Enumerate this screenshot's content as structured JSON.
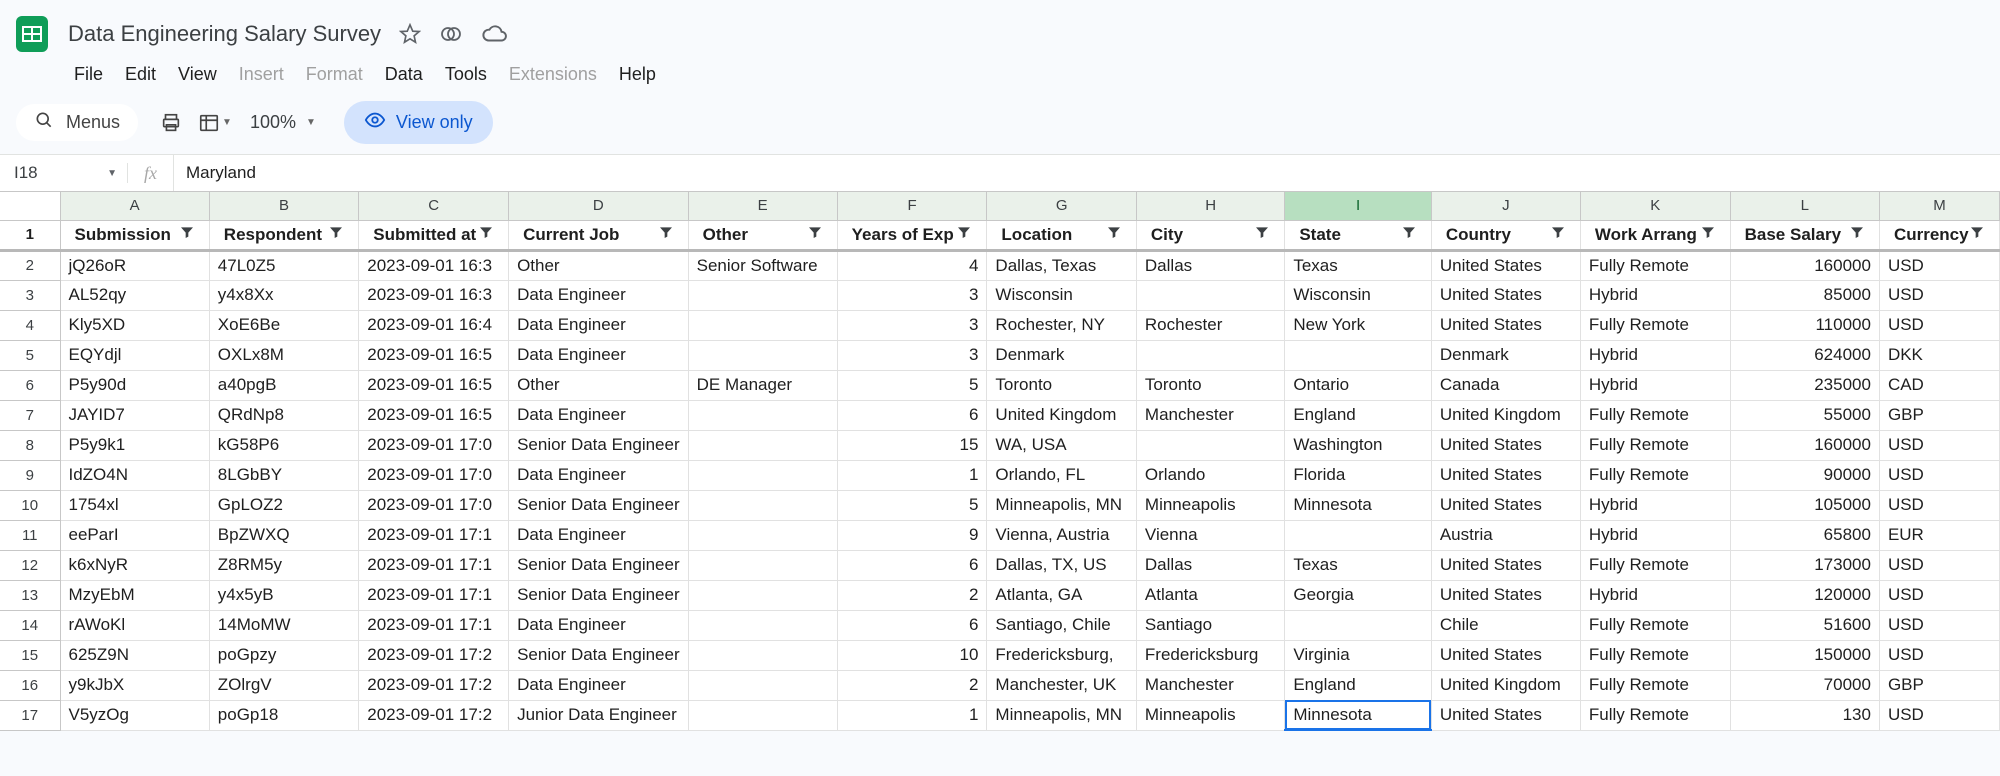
{
  "doc": {
    "title": "Data Engineering Salary Survey"
  },
  "menus": {
    "file": "File",
    "edit": "Edit",
    "view": "View",
    "insert": "Insert",
    "format": "Format",
    "data": "Data",
    "tools": "Tools",
    "extensions": "Extensions",
    "help": "Help"
  },
  "toolbar": {
    "menus_label": "Menus",
    "zoom": "100%",
    "view_only": "View only"
  },
  "namebox": {
    "ref": "I18",
    "formula": "Maryland"
  },
  "columns": [
    "A",
    "B",
    "C",
    "D",
    "E",
    "F",
    "G",
    "H",
    "I",
    "J",
    "K",
    "L",
    "M"
  ],
  "active_col_index": 8,
  "headers": [
    "Submission",
    "Respondent",
    "Submitted at",
    "Current Job",
    "Other",
    "Years of Exp",
    "Location",
    "City",
    "State",
    "Country",
    "Work Arrang",
    "Base Salary",
    "Currency"
  ],
  "rows": [
    {
      "n": 1,
      "cells": [
        "jQ26oR",
        "47L0Z5",
        "2023-09-01 16:3",
        "Other",
        "Senior Software",
        "4",
        "Dallas, Texas",
        "Dallas",
        "Texas",
        "United States",
        "Fully Remote",
        "160000",
        "USD"
      ]
    },
    {
      "n": 2,
      "cells": [
        "AL52qy",
        "y4x8Xx",
        "2023-09-01 16:3",
        "Data Engineer",
        "",
        "3",
        "Wisconsin",
        "",
        "Wisconsin",
        "United States",
        "Hybrid",
        "85000",
        "USD"
      ]
    },
    {
      "n": 3,
      "cells": [
        "Kly5XD",
        "XoE6Be",
        "2023-09-01 16:4",
        "Data Engineer",
        "",
        "3",
        "Rochester, NY",
        "Rochester",
        "New York",
        "United States",
        "Fully Remote",
        "110000",
        "USD"
      ]
    },
    {
      "n": 4,
      "cells": [
        "EQYdjl",
        "OXLx8M",
        "2023-09-01 16:5",
        "Data Engineer",
        "",
        "3",
        "Denmark",
        "",
        "",
        "Denmark",
        "Hybrid",
        "624000",
        "DKK"
      ]
    },
    {
      "n": 5,
      "cells": [
        "P5y90d",
        "a40pgB",
        "2023-09-01 16:5",
        "Other",
        "DE Manager",
        "5",
        "Toronto",
        "Toronto",
        "Ontario",
        "Canada",
        "Hybrid",
        "235000",
        "CAD"
      ]
    },
    {
      "n": 6,
      "cells": [
        "JAYID7",
        "QRdNp8",
        "2023-09-01 16:5",
        "Data Engineer",
        "",
        "6",
        "United Kingdom",
        "Manchester",
        "England",
        "United Kingdom",
        "Fully Remote",
        "55000",
        "GBP"
      ]
    },
    {
      "n": 7,
      "cells": [
        "P5y9k1",
        "kG58P6",
        "2023-09-01 17:0",
        "Senior Data Engineer",
        "",
        "15",
        "WA, USA",
        "",
        "Washington",
        "United States",
        "Fully Remote",
        "160000",
        "USD"
      ]
    },
    {
      "n": 8,
      "cells": [
        "IdZO4N",
        "8LGbBY",
        "2023-09-01 17:0",
        "Data Engineer",
        "",
        "1",
        "Orlando, FL",
        "Orlando",
        "Florida",
        "United States",
        "Fully Remote",
        "90000",
        "USD"
      ]
    },
    {
      "n": 9,
      "cells": [
        "1754xl",
        "GpLOZ2",
        "2023-09-01 17:0",
        "Senior Data Engineer",
        "",
        "5",
        "Minneapolis, MN",
        "Minneapolis",
        "Minnesota",
        "United States",
        "Hybrid",
        "105000",
        "USD"
      ]
    },
    {
      "n": 10,
      "cells": [
        "eeParI",
        "BpZWXQ",
        "2023-09-01 17:1",
        "Data Engineer",
        "",
        "9",
        "Vienna, Austria",
        "Vienna",
        "",
        "Austria",
        "Hybrid",
        "65800",
        "EUR"
      ]
    },
    {
      "n": 11,
      "cells": [
        "k6xNyR",
        "Z8RM5y",
        "2023-09-01 17:1",
        "Senior Data Engineer",
        "",
        "6",
        "Dallas, TX, US",
        "Dallas",
        "Texas",
        "United States",
        "Fully Remote",
        "173000",
        "USD"
      ]
    },
    {
      "n": 12,
      "cells": [
        "MzyEbM",
        "y4x5yB",
        "2023-09-01 17:1",
        "Senior Data Engineer",
        "",
        "2",
        "Atlanta, GA",
        "Atlanta",
        "Georgia",
        "United States",
        "Hybrid",
        "120000",
        "USD"
      ]
    },
    {
      "n": 13,
      "cells": [
        "rAWoKl",
        "14MoMW",
        "2023-09-01 17:1",
        "Data Engineer",
        "",
        "6",
        "Santiago, Chile",
        "Santiago",
        "",
        "Chile",
        "Fully Remote",
        "51600",
        "USD"
      ]
    },
    {
      "n": 14,
      "cells": [
        "625Z9N",
        "poGpzy",
        "2023-09-01 17:2",
        "Senior Data Engineer",
        "",
        "10",
        "Fredericksburg,",
        "Fredericksburg",
        "Virginia",
        "United States",
        "Fully Remote",
        "150000",
        "USD"
      ]
    },
    {
      "n": 15,
      "cells": [
        "y9kJbX",
        "ZOlrgV",
        "2023-09-01 17:2",
        "Data Engineer",
        "",
        "2",
        "Manchester, UK",
        "Manchester",
        "England",
        "United Kingdom",
        "Fully Remote",
        "70000",
        "GBP"
      ]
    },
    {
      "n": 16,
      "cells": [
        "V5yzOg",
        "poGp18",
        "2023-09-01 17:2",
        "Junior Data Engineer",
        "",
        "1",
        "Minneapolis, MN",
        "Minneapolis",
        "Minnesota",
        "United States",
        "Fully Remote",
        "130",
        "USD"
      ]
    }
  ],
  "numeric_cols": [
    5,
    11
  ],
  "overflow_cols": [
    3
  ],
  "selected": {
    "row_index": 15,
    "col_index": 8
  }
}
